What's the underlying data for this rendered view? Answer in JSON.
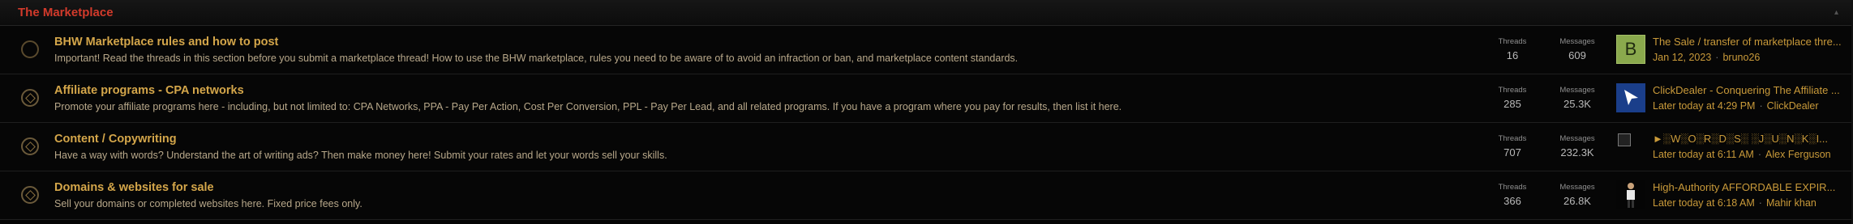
{
  "block": {
    "title": "The Marketplace",
    "collapse_icon": "chevron-up-icon"
  },
  "forums": [
    {
      "title": "BHW Marketplace rules and how to post",
      "description": "Important! Read the threads in this section before you submit a marketplace thread! How to use the BHW marketplace, rules you need to be aware of to avoid an infraction or ban, and marketplace content standards.",
      "threads_label": "Threads",
      "threads": "16",
      "messages_label": "Messages",
      "messages": "609",
      "avatar_letter": "B",
      "last_title": "The Sale / transfer of marketplace thre...",
      "last_date": "Jan 12, 2023",
      "last_user": "bruno26"
    },
    {
      "title": "Affiliate programs - CPA networks",
      "description": "Promote your affiliate programs here - including, but not limited to: CPA Networks, PPA - Pay Per Action, Cost Per Conversion, PPL - Pay Per Lead, and all related programs. If you have a program where you pay for results, then list it here.",
      "threads_label": "Threads",
      "threads": "285",
      "messages_label": "Messages",
      "messages": "25.3K",
      "last_title": "ClickDealer - Conquering The Affiliate ...",
      "last_date": "Later today at 4:29 PM",
      "last_user": "ClickDealer"
    },
    {
      "title": "Content / Copywriting",
      "description": "Have a way with words? Understand the art of writing ads? Then make money here! Submit your rates and let your words sell your skills.",
      "threads_label": "Threads",
      "threads": "707",
      "messages_label": "Messages",
      "messages": "232.3K",
      "last_title": "►░W░O░R░D░S░ ░J░U░N░K░I...",
      "last_date": "Later today at 6:11 AM",
      "last_user": "Alex Ferguson"
    },
    {
      "title": "Domains & websites for sale",
      "description": "Sell your domains or completed websites here. Fixed price fees only.",
      "threads_label": "Threads",
      "threads": "366",
      "messages_label": "Messages",
      "messages": "26.8K",
      "last_title": "High-Authority AFFORDABLE EXPIR...",
      "last_date": "Later today at 6:18 AM",
      "last_user": "Mahir khan"
    }
  ],
  "separator": "·",
  "colors": {
    "accent": "#d23a2b",
    "link": "#d4a64a",
    "background": "#050505"
  }
}
